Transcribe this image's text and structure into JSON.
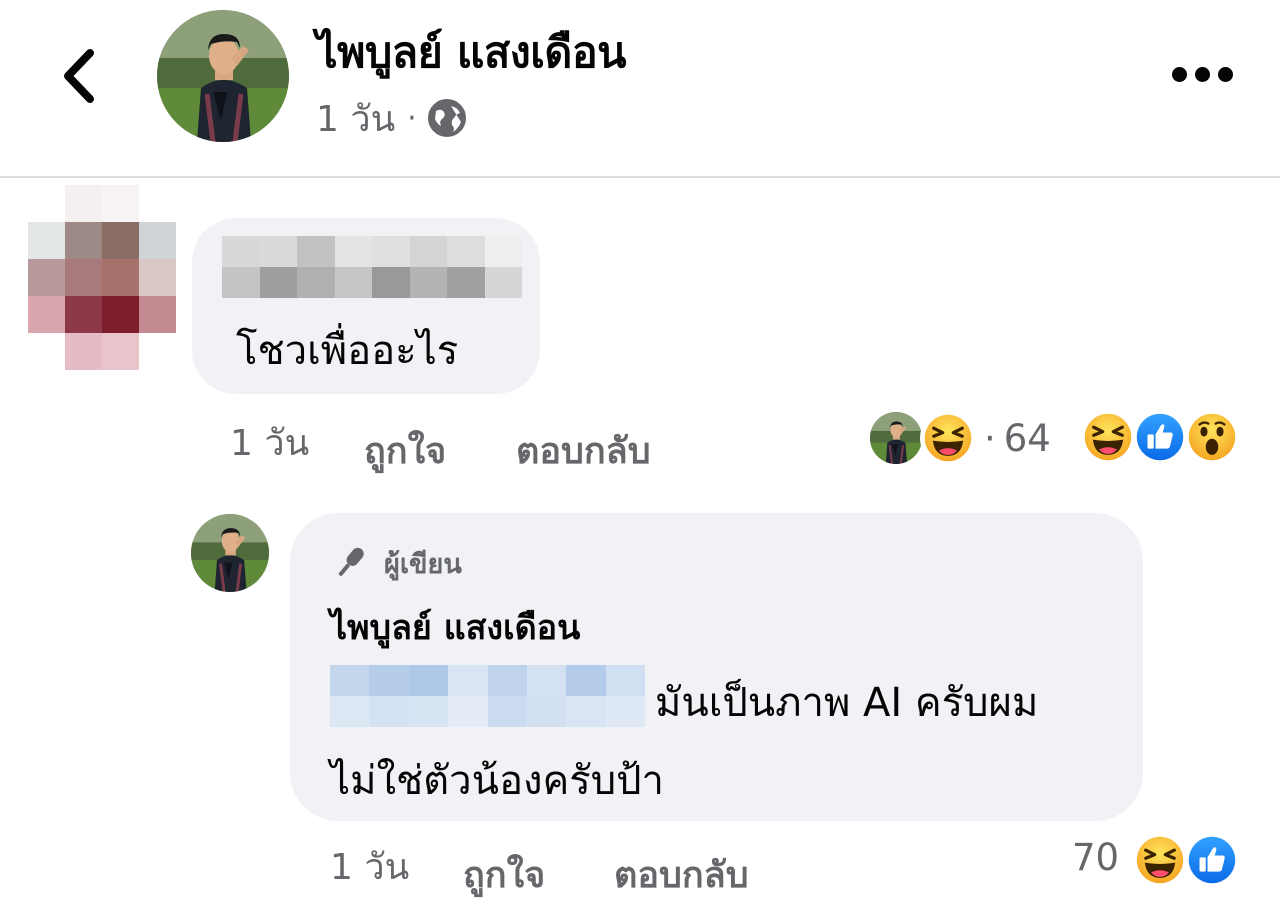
{
  "header": {
    "author_name": "ไพบูลย์ แสงเดือน",
    "time": "1 วัน",
    "separator": "·",
    "privacy_icon": "globe-icon",
    "back_icon": "chevron-left-icon",
    "more_icon": "more-horizontal-icon"
  },
  "comments": [
    {
      "text": "โชวเพื่ออะไร",
      "time": "1 วัน",
      "like_label": "ถูกใจ",
      "reply_label": "ตอบกลับ",
      "reactor_dot": "·",
      "reaction_count": "64",
      "reactor_reaction": "haha-emoji",
      "reactions": [
        "haha-emoji",
        "like-emoji",
        "wow-emoji"
      ]
    }
  ],
  "reply": {
    "badge_label": "ผู้เขียน",
    "badge_icon": "microphone-icon",
    "author_name": "ไพบูลย์ แสงเดือน",
    "line1": "มันเป็นภาพ AI ครับผม",
    "line2": "ไม่ใช่ตัวน้องครับป้า",
    "time": "1 วัน",
    "like_label": "ถูกใจ",
    "reply_label": "ตอบกลับ",
    "reaction_count": "70",
    "reactions": [
      "haha-emoji",
      "like-emoji"
    ]
  },
  "colors": {
    "text_primary": "#050505",
    "text_secondary": "#65676b",
    "bubble_bg": "#f0f2f5",
    "like_blue": "#1877f2",
    "emoji_yellow": "#fbc531"
  }
}
